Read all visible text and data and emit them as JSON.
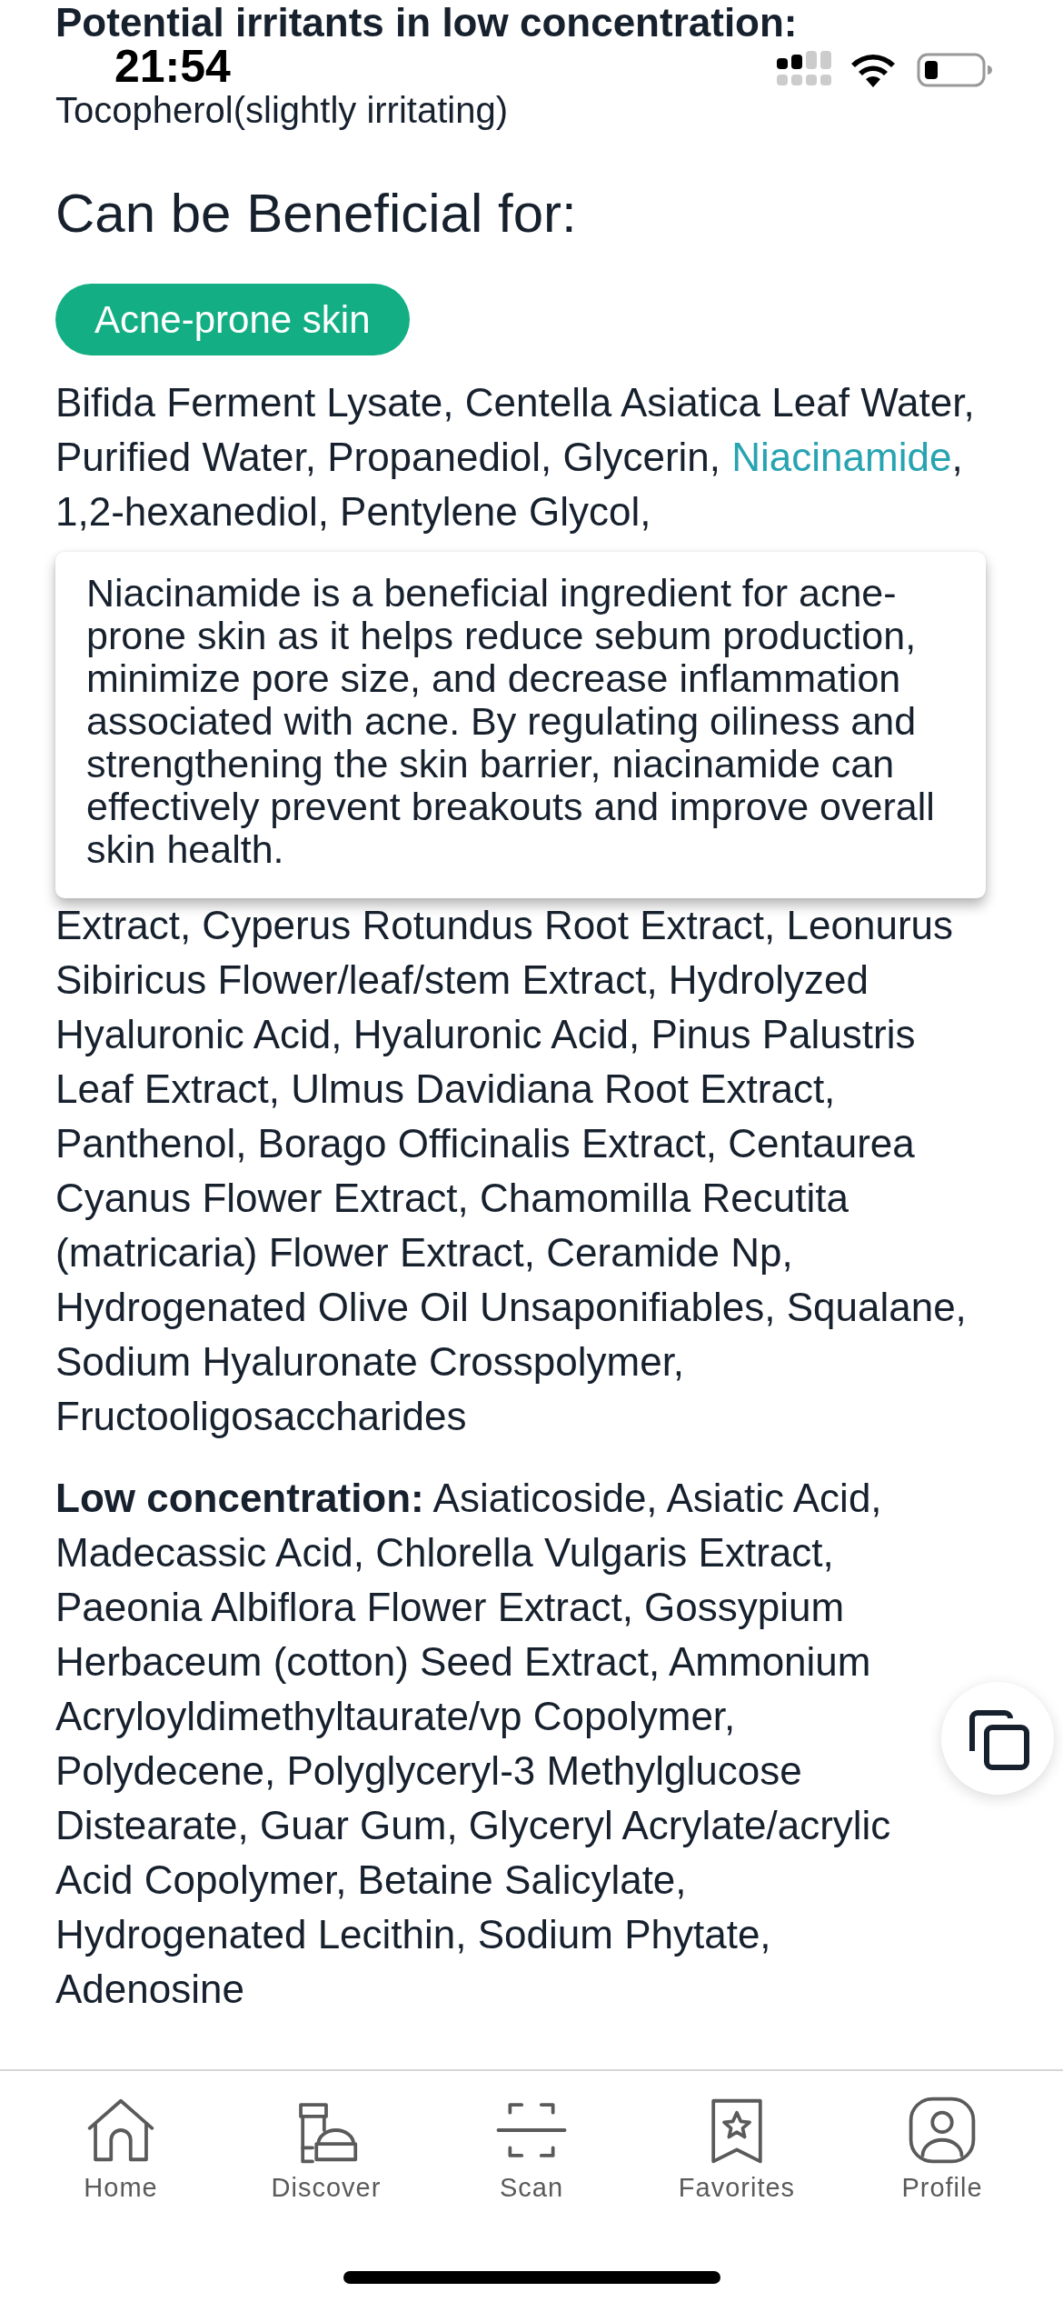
{
  "status_bar": {
    "time": "21:54"
  },
  "irritants": {
    "heading": "Potential irritants in low concentration:",
    "text": "Tocopherol(slightly irritating)"
  },
  "beneficial": {
    "heading": "Can be Beneficial for:",
    "tags": [
      {
        "label": "Acne-prone skin"
      }
    ]
  },
  "ingredients": {
    "segments": [
      {
        "text": "Bifida Ferment Lysate, Centella Asiatica Leaf Water, Purified Water, Propanediol, Glycerin, ",
        "highlighted": false
      },
      {
        "text": "Niacinamide",
        "highlighted": true
      },
      {
        "text": ", 1,2-hexanediol, Pentylene Glycol,",
        "highlighted": false
      }
    ]
  },
  "tooltip": {
    "text": "Niacinamide is a beneficial ingredient for acne-prone skin as it helps reduce sebum production, minimize pore size, and decrease inflammation associated with acne. By regulating oiliness and strengthening the skin barrier, niacinamide can effectively prevent breakouts and improve overall skin health."
  },
  "ingredients_continued": "Extract, Cyperus Rotundus Root Extract, Leonurus Sibiricus Flower/leaf/stem Extract, Hydrolyzed Hyaluronic Acid, Hyaluronic Acid, Pinus Palustris Leaf Extract, Ulmus Davidiana Root Extract, Panthenol, Borago Officinalis Extract, Centaurea Cyanus Flower Extract, Chamomilla Recutita (matricaria) Flower Extract, Ceramide Np, Hydrogenated Olive Oil Unsaponifiables, Squalane, Sodium Hyaluronate Crosspolymer, Fructooligosaccharides",
  "low_concentration": "**Low concentration:** Asiaticoside, Asiatic Acid, Madecassic Acid, Chlorella Vulgaris Extract, Paeonia Albiflora Flower Extract, Gossypium Herbaceum (cotton) Seed Extract, Ammonium Acryloyldimethyltaurate/vp Copolymer, Polydecene, Polyglyceryl-3 Methylglucose Distearate, Guar Gum, Glyceryl Acrylate/acrylic Acid Copolymer, Betaine Salicylate, Hydrogenated Lecithin, Sodium Phytate, Adenosine",
  "nav": [
    {
      "kind": "home",
      "label": "Home"
    },
    {
      "kind": "discover",
      "label": "Discover"
    },
    {
      "kind": "scan",
      "label": "Scan"
    },
    {
      "kind": "favorites",
      "label": "Favorites"
    },
    {
      "kind": "profile",
      "label": "Profile"
    }
  ]
}
